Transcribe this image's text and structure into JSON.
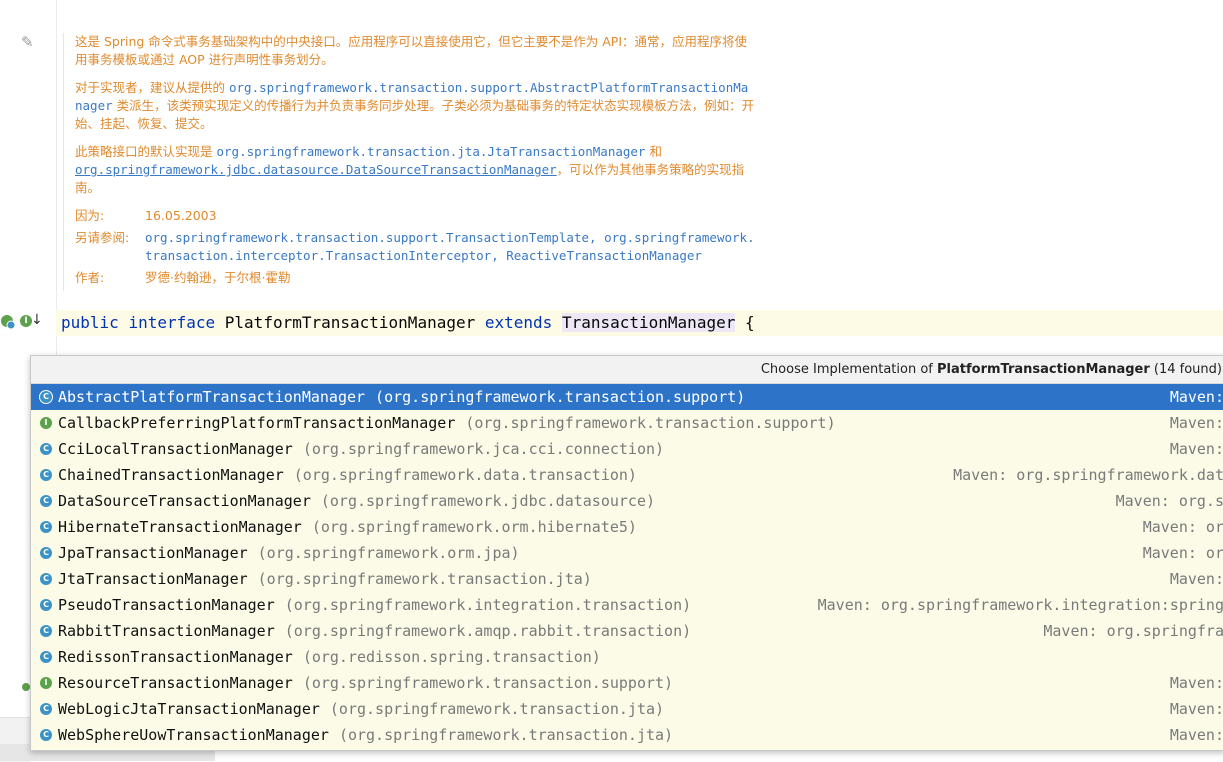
{
  "doc": {
    "para1": "这是 Spring 命令式事务基础架构中的中央接口。应用程序可以直接使用它，但它主要不是作为 API：通常，应用程序将使用事务模板或通过 AOP 进行声明性事务划分。",
    "para2_prefix": "对于实现者，建议从提供的",
    "para2_code1": "org.springframework.transaction.support.AbstractPlatformTransactionManager",
    "para2_suffix": "类派生，该类预实现定义的传播行为并负责事务同步处理。子类必须为基础事务的特定状态实现模板方法，例如：开始、挂起、恢复、提交。",
    "para3_prefix": "此策略接口的默认实现是",
    "para3_code1": "org.springframework.transaction.jta.JtaTransactionManager",
    "para3_and": "和",
    "para3_code2": "org.springframework.jdbc.datasource.DataSourceTransactionManager",
    "para3_suffix": "，可以作为其他事务策略的实现指南。",
    "since_label": "因为:",
    "since_value": "16.05.2003",
    "see_label": "另请参阅:",
    "see_value1": "org.springframework.transaction.support.TransactionTemplate",
    "see_sep1": ", ",
    "see_value2": "org.springframework.transaction.interceptor.TransactionInterceptor",
    "see_sep2": ", ",
    "see_value3": "ReactiveTransactionManager",
    "author_label": "作者:",
    "author_value": "罗德·约翰逊，于尔根·霍勒"
  },
  "code": {
    "kw1": "public",
    "kw2": "interface",
    "name": "PlatformTransactionManager",
    "kw3": "extends",
    "parent": "TransactionManager",
    "brace": "{"
  },
  "popup": {
    "title_prefix": "Choose Implementation of",
    "title_name": "PlatformTransactionManager",
    "title_count": "(14 found)",
    "items": [
      {
        "name": "AbstractPlatformTransactionManager",
        "pkg": "(org.springframework.transaction.support)",
        "maven": "Maven:",
        "kind": "abstract",
        "selected": true
      },
      {
        "name": "CallbackPreferringPlatformTransactionManager",
        "pkg": "(org.springframework.transaction.support)",
        "maven": "Maven:",
        "kind": "interface"
      },
      {
        "name": "CciLocalTransactionManager",
        "pkg": "(org.springframework.jca.cci.connection)",
        "maven": "Maven:",
        "kind": "class"
      },
      {
        "name": "ChainedTransactionManager",
        "pkg": "(org.springframework.data.transaction)",
        "maven": "Maven: org.springframework.dat",
        "kind": "class"
      },
      {
        "name": "DataSourceTransactionManager",
        "pkg": "(org.springframework.jdbc.datasource)",
        "maven": "Maven: org.s",
        "kind": "class"
      },
      {
        "name": "HibernateTransactionManager",
        "pkg": "(org.springframework.orm.hibernate5)",
        "maven": "Maven: or",
        "kind": "class"
      },
      {
        "name": "JpaTransactionManager",
        "pkg": "(org.springframework.orm.jpa)",
        "maven": "Maven: or",
        "kind": "class"
      },
      {
        "name": "JtaTransactionManager",
        "pkg": "(org.springframework.transaction.jta)",
        "maven": "Maven:",
        "kind": "class"
      },
      {
        "name": "PseudoTransactionManager",
        "pkg": "(org.springframework.integration.transaction)",
        "maven": "Maven: org.springframework.integration:spring",
        "kind": "class"
      },
      {
        "name": "RabbitTransactionManager",
        "pkg": "(org.springframework.amqp.rabbit.transaction)",
        "maven": "Maven: org.springfra",
        "kind": "class"
      },
      {
        "name": "RedissonTransactionManager",
        "pkg": "(org.redisson.spring.transaction)",
        "maven": "",
        "kind": "class"
      },
      {
        "name": "ResourceTransactionManager",
        "pkg": "(org.springframework.transaction.support)",
        "maven": "Maven:",
        "kind": "interface"
      },
      {
        "name": "WebLogicJtaTransactionManager",
        "pkg": "(org.springframework.transaction.jta)",
        "maven": "Maven:",
        "kind": "class"
      },
      {
        "name": "WebSphereUowTransactionManager",
        "pkg": "(org.springframework.transaction.jta)",
        "maven": "Maven:",
        "kind": "class"
      }
    ]
  },
  "icons": {
    "edit": "pencil-icon",
    "implemented": "implemented-gutter-icon",
    "interface_badge": "interface-badge-icon",
    "goto": "down-arrow-icon",
    "class": "class-icon",
    "interface": "interface-icon"
  },
  "colors": {
    "doc_text": "#e08a2e",
    "doc_link": "#3a79c5",
    "keyword": "#0033b3",
    "selection": "#2d74c8",
    "popup_bg": "#fbfbe8"
  }
}
